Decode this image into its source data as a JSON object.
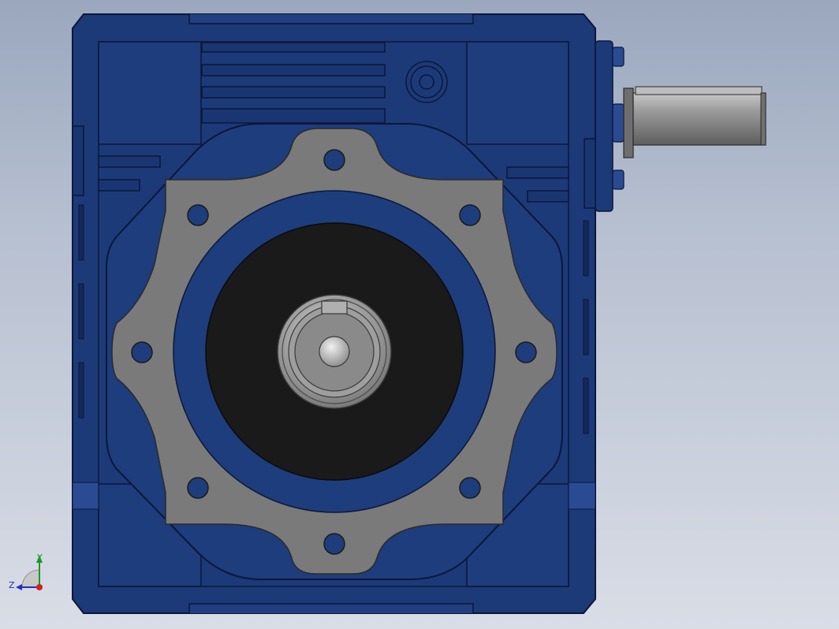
{
  "viewport": {
    "background_top": "#9aa7bd",
    "background_bottom": "#d9dde6"
  },
  "model": {
    "housing_color": "#1c3a78",
    "housing_shade": "#14295a",
    "housing_edge": "#0b173a",
    "flange_color": "#7a7a7a",
    "bore_color": "#1a1a1a",
    "shaft_color": "#8c8c8c"
  },
  "triad": {
    "x_color": "#d42020",
    "y_color": "#1a9a2a",
    "z_color": "#2030c0",
    "y_label": "Y",
    "z_label": "Z"
  }
}
